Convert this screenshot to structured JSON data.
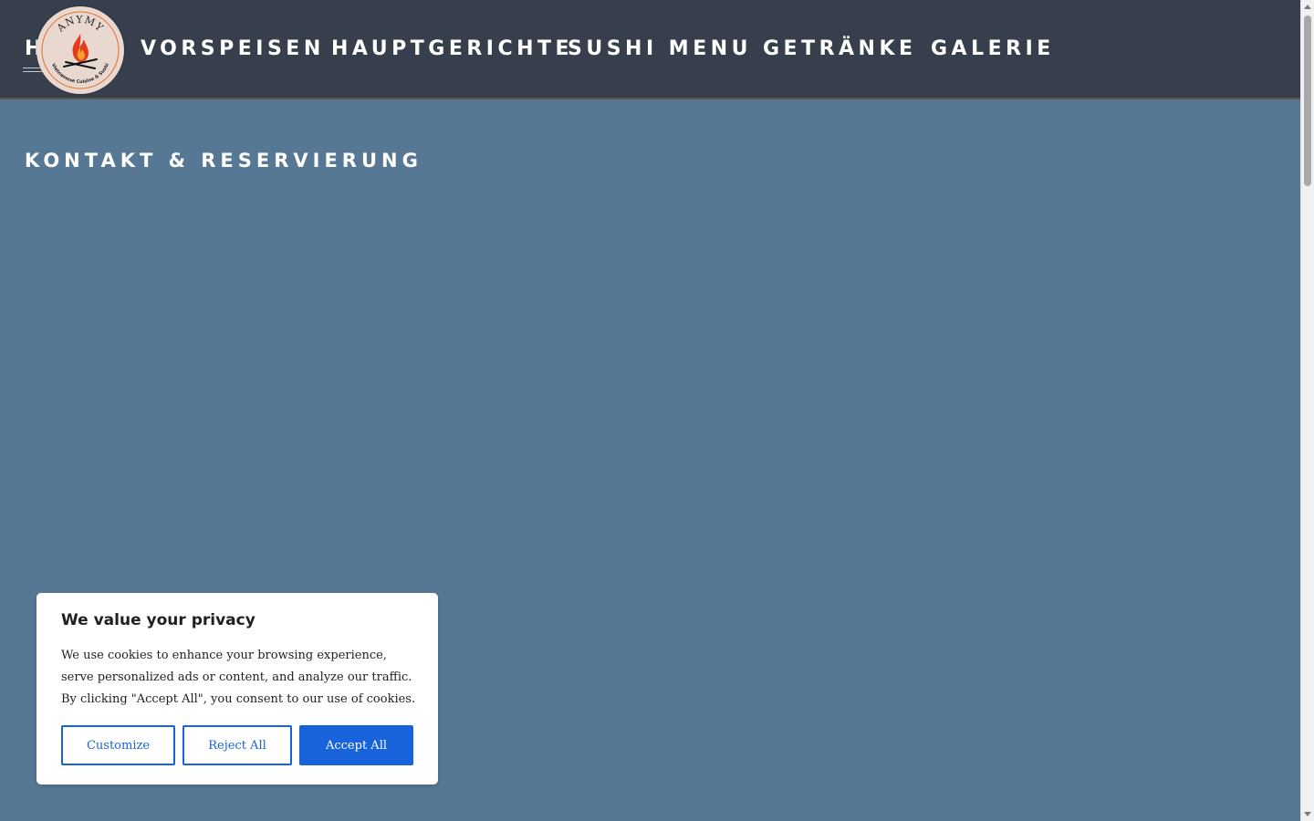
{
  "nav": {
    "items": [
      {
        "label": "H"
      },
      {
        "label": "VORSPEISEN"
      },
      {
        "label": "HAUPTGERICHTE"
      },
      {
        "label": "SUSHI MENU"
      },
      {
        "label": "GETRÄNKE"
      },
      {
        "label": "GALERIE"
      }
    ]
  },
  "logo": {
    "name": "ANYMY",
    "tagline": "Vietnamese Cuisine & Sushi"
  },
  "main": {
    "section_title": "KONTAKT & RESERVIERUNG"
  },
  "cookie_banner": {
    "title": "We value your privacy",
    "text": "We use cookies to enhance your browsing experience, serve personalized ads or content, and analyze our traffic. By clicking \"Accept All\", you consent to our use of cookies.",
    "customize_label": "Customize",
    "reject_label": "Reject All",
    "accept_label": "Accept All"
  },
  "colors": {
    "header_bg": "#363f4b",
    "page_bg": "#567894",
    "accent_button": "#1863dc"
  }
}
